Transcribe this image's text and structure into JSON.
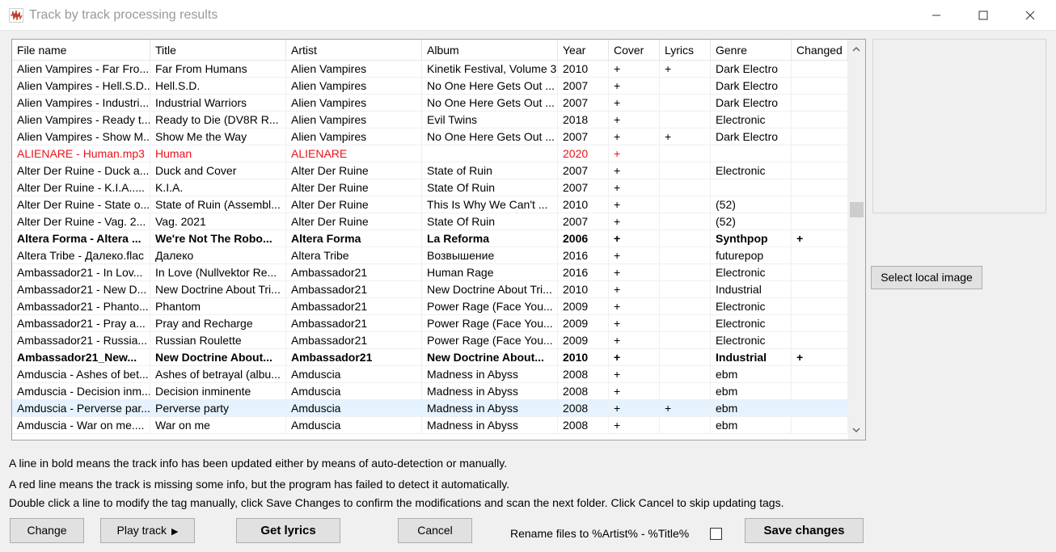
{
  "window": {
    "title": "Track by track processing results",
    "icons": {
      "app": "waveform-icon",
      "minimize": "minimize-icon",
      "maximize": "maximize-icon",
      "close": "close-icon"
    }
  },
  "table": {
    "columns": [
      "File name",
      "Title",
      "Artist",
      "Album",
      "Year",
      "Cover",
      "Lyrics",
      "Genre",
      "Changed"
    ],
    "rows": [
      {
        "cells": [
          "Alien Vampires - Far Fro...",
          "Far From Humans",
          "Alien Vampires",
          "Kinetik Festival, Volume 3",
          "2010",
          "+",
          "+",
          "Dark Electro",
          ""
        ],
        "style": "normal"
      },
      {
        "cells": [
          "Alien Vampires - Hell.S.D...",
          "Hell.S.D.",
          "Alien Vampires",
          "No One Here Gets Out ...",
          "2007",
          "+",
          "",
          "Dark Electro",
          ""
        ],
        "style": "normal"
      },
      {
        "cells": [
          "Alien Vampires - Industri...",
          "Industrial Warriors",
          "Alien Vampires",
          "No One Here Gets Out ...",
          "2007",
          "+",
          "",
          "Dark Electro",
          ""
        ],
        "style": "normal"
      },
      {
        "cells": [
          "Alien Vampires - Ready t...",
          "Ready to Die (DV8R R...",
          "Alien Vampires",
          "Evil Twins",
          "2018",
          "+",
          "",
          "Electronic",
          ""
        ],
        "style": "normal"
      },
      {
        "cells": [
          "Alien Vampires - Show M...",
          "Show Me the Way",
          "Alien Vampires",
          "No One Here Gets Out ...",
          "2007",
          "+",
          "+",
          "Dark Electro",
          ""
        ],
        "style": "normal"
      },
      {
        "cells": [
          "ALIENARE - Human.mp3",
          "Human",
          "ALIENARE",
          "",
          "2020",
          "+",
          "",
          "",
          ""
        ],
        "style": "missing"
      },
      {
        "cells": [
          "Alter Der Ruine - Duck a...",
          "Duck and Cover",
          "Alter Der Ruine",
          "State of Ruin",
          "2007",
          "+",
          "",
          "Electronic",
          ""
        ],
        "style": "normal"
      },
      {
        "cells": [
          "Alter Der Ruine - K.I.A.....",
          "K.I.A.",
          "Alter Der Ruine",
          "State Of Ruin",
          "2007",
          "+",
          "",
          "",
          ""
        ],
        "style": "normal"
      },
      {
        "cells": [
          "Alter Der Ruine - State o...",
          "State of Ruin (Assembl...",
          "Alter Der Ruine",
          "This Is Why We Can't ...",
          "2010",
          "+",
          "",
          "(52)",
          ""
        ],
        "style": "normal"
      },
      {
        "cells": [
          "Alter Der Ruine - Vag. 2...",
          "Vag. 2021",
          "Alter Der Ruine",
          "State Of Ruin",
          "2007",
          "+",
          "",
          "(52)",
          ""
        ],
        "style": "normal"
      },
      {
        "cells": [
          "Altera Forma - Altera ...",
          "We're Not The Robo...",
          "Altera Forma",
          "La Reforma",
          "2006",
          "+",
          "",
          "Synthpop",
          "+"
        ],
        "style": "bold"
      },
      {
        "cells": [
          "Altera Tribe - Далеко.flac",
          "Далеко",
          "Altera Tribe",
          "Возвышение",
          "2016",
          "+",
          "",
          "futurepop",
          ""
        ],
        "style": "normal"
      },
      {
        "cells": [
          "Ambassador21 - In Lov...",
          "In Love (Nullvektor Re...",
          "Ambassador21",
          "Human Rage",
          "2016",
          "+",
          "",
          "Electronic",
          ""
        ],
        "style": "normal"
      },
      {
        "cells": [
          "Ambassador21 - New D...",
          "New Doctrine About Tri...",
          "Ambassador21",
          "New Doctrine About Tri...",
          "2010",
          "+",
          "",
          "Industrial",
          ""
        ],
        "style": "normal"
      },
      {
        "cells": [
          "Ambassador21 - Phanto...",
          "Phantom",
          "Ambassador21",
          "Power Rage (Face You...",
          "2009",
          "+",
          "",
          "Electronic",
          ""
        ],
        "style": "normal"
      },
      {
        "cells": [
          "Ambassador21 - Pray a...",
          "Pray and Recharge",
          "Ambassador21",
          "Power Rage (Face You...",
          "2009",
          "+",
          "",
          "Electronic",
          ""
        ],
        "style": "normal"
      },
      {
        "cells": [
          "Ambassador21 - Russia...",
          "Russian Roulette",
          "Ambassador21",
          "Power Rage (Face You...",
          "2009",
          "+",
          "",
          "Electronic",
          ""
        ],
        "style": "normal"
      },
      {
        "cells": [
          "Ambassador21_New...",
          "New Doctrine About...",
          "Ambassador21",
          "New Doctrine About...",
          "2010",
          "+",
          "",
          "Industrial",
          "+"
        ],
        "style": "bold"
      },
      {
        "cells": [
          "Amduscia - Ashes of bet...",
          "Ashes of betrayal (albu...",
          "Amduscia",
          "Madness in Abyss",
          "2008",
          "+",
          "",
          "ebm",
          ""
        ],
        "style": "normal"
      },
      {
        "cells": [
          "Amduscia - Decision inm...",
          "Decision inminente",
          "Amduscia",
          "Madness in Abyss",
          "2008",
          "+",
          "",
          "ebm",
          ""
        ],
        "style": "normal"
      },
      {
        "cells": [
          "Amduscia - Perverse par...",
          "Perverse party",
          "Amduscia",
          "Madness in Abyss",
          "2008",
          "+",
          "+",
          "ebm",
          ""
        ],
        "style": "selected"
      },
      {
        "cells": [
          "Amduscia - War on me....",
          "War on me",
          "Amduscia",
          "Madness in Abyss",
          "2008",
          "+",
          "",
          "ebm",
          ""
        ],
        "style": "normal"
      }
    ]
  },
  "side": {
    "select_image_label": "Select local image"
  },
  "info": {
    "bold_note": "A line in bold means the track info has been updated either by means of auto-detection or manually.",
    "red_note": "A red line means the track is missing some info, but the program has failed to detect it automatically.",
    "instructions": "Double click a line to modify the tag manually, click Save Changes to confirm the modifications and scan the next folder. Click Cancel to skip updating tags."
  },
  "buttons": {
    "change": "Change",
    "play_track": "Play track",
    "play_glyph": "▶",
    "get_lyrics": "Get lyrics",
    "cancel": "Cancel",
    "save_changes": "Save changes",
    "rename_label": "Rename files to %Artist% - %Title%",
    "rename_checked": false
  },
  "colors": {
    "missing_text": "#e8141b",
    "selected_row": "#e5f3ff"
  }
}
